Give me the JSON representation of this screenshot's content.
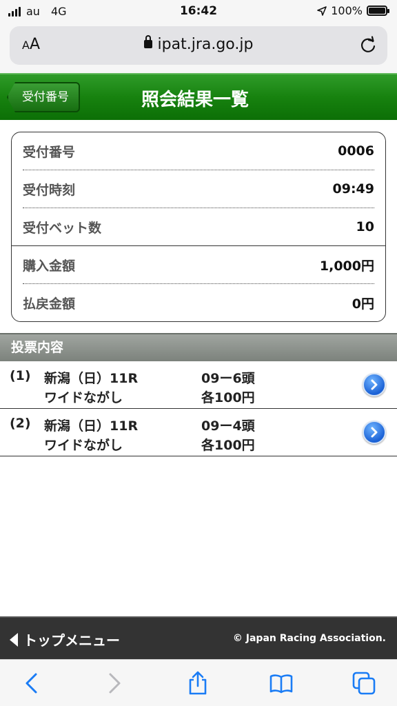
{
  "status_bar": {
    "carrier": "au",
    "network": "4G",
    "time": "16:42",
    "battery": "100%"
  },
  "browser": {
    "aa_label_small": "A",
    "aa_label_large": "A",
    "url": "ipat.jra.go.jp"
  },
  "header": {
    "back_label": "受付番号",
    "title": "照会結果一覧"
  },
  "receipt": {
    "rows": [
      {
        "label": "受付番号",
        "value": "0006"
      },
      {
        "label": "受付時刻",
        "value": "09:49"
      },
      {
        "label": "受付ベット数",
        "value": "10"
      },
      {
        "label": "購入金額",
        "value": "1,000円"
      },
      {
        "label": "払戻金額",
        "value": "0円"
      }
    ]
  },
  "bets": {
    "section_title": "投票内容",
    "items": [
      {
        "no": "(1)",
        "race": "新潟（日）11R",
        "type": "ワイドながし",
        "horses": "09ー6頭",
        "amount": "各100円"
      },
      {
        "no": "(2)",
        "race": "新潟（日）11R",
        "type": "ワイドながし",
        "horses": "09ー4頭",
        "amount": "各100円"
      }
    ]
  },
  "footer": {
    "top_menu_label": "トップメニュー",
    "copyright": "© Japan Racing Association."
  },
  "colors": {
    "header_green": "#17820f",
    "section_gray": "#8d928d",
    "footer_dark": "#333333",
    "ios_blue": "#1a7cf5"
  }
}
